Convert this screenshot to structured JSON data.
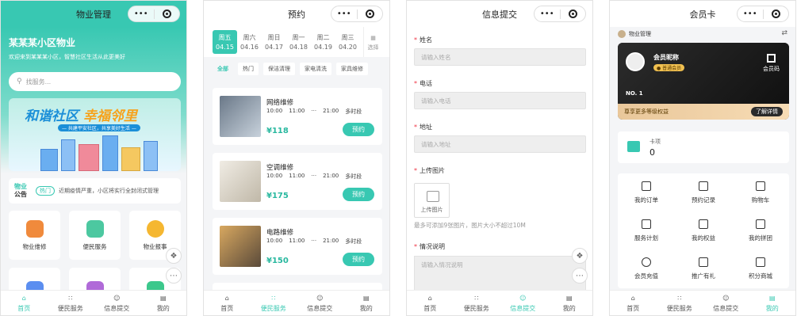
{
  "screens": [
    {
      "title": "物业管理"
    },
    {
      "title": "预约"
    },
    {
      "title": "信息提交"
    },
    {
      "title": "会员卡"
    }
  ],
  "capsule": {
    "more": "•••"
  },
  "home": {
    "community_name": "某某某小区物业",
    "welcome": "欢迎来到某某某小区，智慧社区生活从此更美好",
    "search_placeholder": "找服务...",
    "banner_title_a": "和谐社区",
    "banner_title_b": "幸福邻里",
    "banner_sub": "— 共建平安社区，共享美好生活 —",
    "notice_label_a": "物业",
    "notice_label_b": "公告",
    "notice_tag": "热门",
    "notice_text": "近期疫情严重，小区将实行全封闭式管理",
    "services": [
      {
        "label": "物业维修",
        "color": "#f08a3c"
      },
      {
        "label": "便民服务",
        "color": "#4cc8a0"
      },
      {
        "label": "物业报事",
        "color": "#f5b731"
      },
      {
        "label": "",
        "color": "#5b8ef0"
      },
      {
        "label": "",
        "color": "#b06ad8"
      },
      {
        "label": "",
        "color": "#3cc88c"
      }
    ]
  },
  "booking": {
    "dates": [
      {
        "day": "周五",
        "date": "04.15"
      },
      {
        "day": "周六",
        "date": "04.16"
      },
      {
        "day": "周日",
        "date": "04.17"
      },
      {
        "day": "周一",
        "date": "04.18"
      },
      {
        "day": "周二",
        "date": "04.19"
      },
      {
        "day": "周三",
        "date": "04.20"
      }
    ],
    "calendar_label": "选择",
    "categories": [
      "全部",
      "热门",
      "保洁清理",
      "家电清洗",
      "家具维修"
    ],
    "items": [
      {
        "name": "网络维修",
        "t1": "10:00",
        "t2": "11:00",
        "dash": "···",
        "t3": "21:00",
        "more": "多时段",
        "price": "¥118",
        "button": "预约",
        "color": "#9aa8b8"
      },
      {
        "name": "空调维修",
        "t1": "10:00",
        "t2": "11:00",
        "dash": "···",
        "t3": "21:00",
        "more": "多时段",
        "price": "¥175",
        "button": "预约",
        "color": "#d8d2c8"
      },
      {
        "name": "电路维修",
        "t1": "10:00",
        "t2": "11:00",
        "dash": "···",
        "t3": "21:00",
        "more": "多时段",
        "price": "¥150",
        "button": "预约",
        "color": "#c89858"
      }
    ]
  },
  "form": {
    "name_label": "姓名",
    "name_ph": "请输入姓名",
    "phone_label": "电话",
    "phone_ph": "请输入电话",
    "addr_label": "地址",
    "addr_ph": "请输入地址",
    "img_label": "上传图片",
    "img_btn": "上传图片",
    "img_hint": "最多可添加9张图片，图片大小不超过10M",
    "desc_label": "情况说明",
    "desc_ph": "请输入情况说明",
    "required": "*"
  },
  "member": {
    "org": "物业管理",
    "nickname": "会员昵称",
    "level": "● 普通会员",
    "qr_label": "会员码",
    "no": "NO. 1",
    "tip": "尊享更多等级权益",
    "detail": "了解详情",
    "card_label": "卡项",
    "card_value": "0",
    "menu": [
      "我的订单",
      "预约记录",
      "购物车",
      "服务计划",
      "我的权益",
      "我的拼团",
      "会员充值",
      "推广有礼",
      "积分商城"
    ]
  },
  "tabbar": [
    "首页",
    "便民服务",
    "信息提交",
    "我的"
  ],
  "accent": "#38c8b2"
}
